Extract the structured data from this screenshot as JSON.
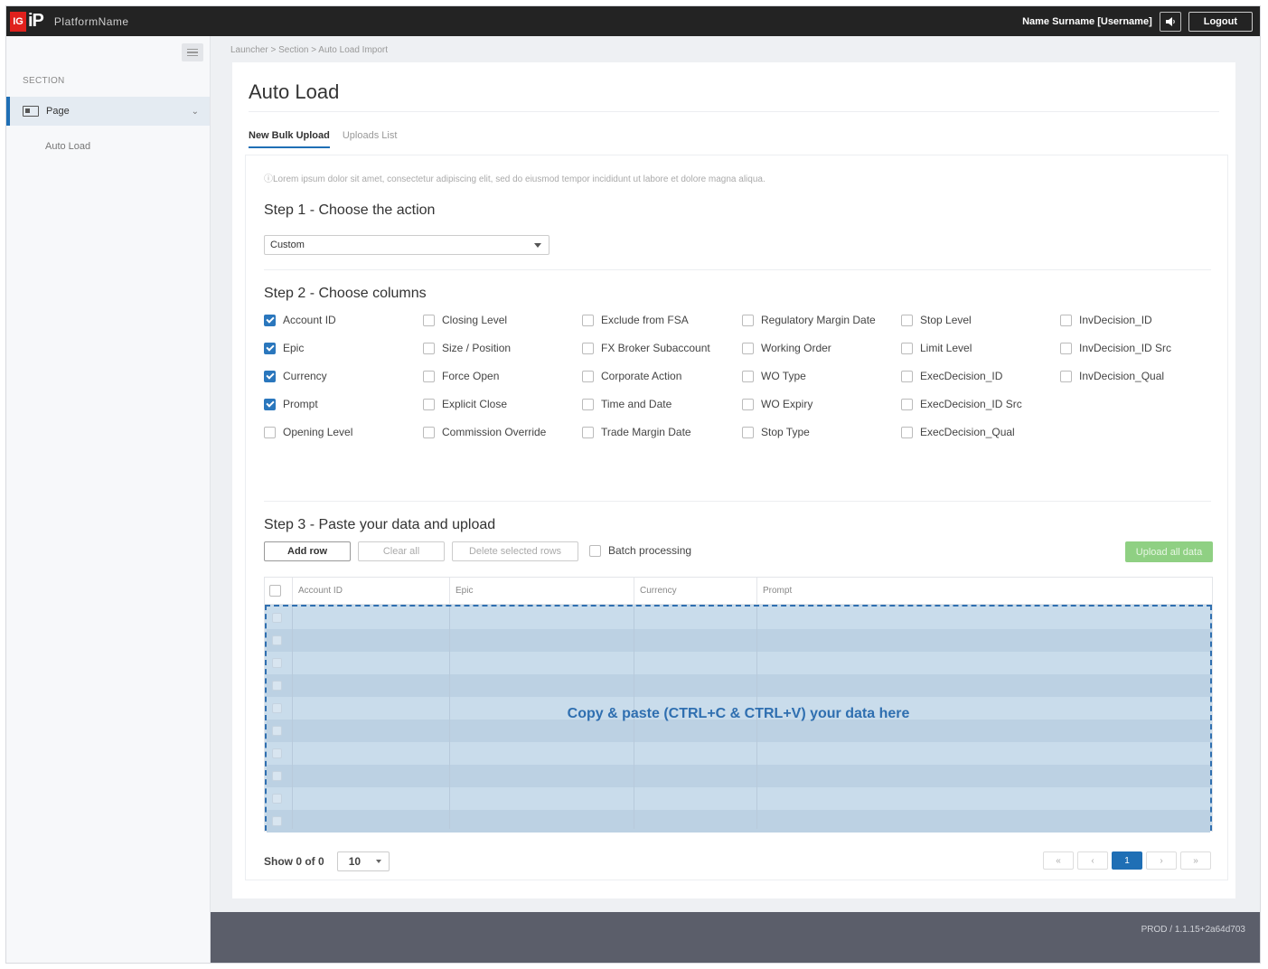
{
  "header": {
    "logo_ig": "IG",
    "logo_ip": "iP",
    "platform_name": "PlatformName",
    "user": "Name Surname [Username]",
    "logout_label": "Logout"
  },
  "sidebar": {
    "section_label": "SECTION",
    "item_label": "Page",
    "sub_item_label": "Auto Load"
  },
  "breadcrumb": "Launcher > Section > Auto Load Import",
  "page_title": "Auto Load",
  "tabs": [
    {
      "label": "New Bulk Upload",
      "active": true
    },
    {
      "label": "Uploads List",
      "active": false
    }
  ],
  "info_text": "ⓘLorem ipsum dolor sit amet, consectetur adipiscing elit, sed do eiusmod tempor incididunt ut labore et dolore magna aliqua.",
  "step1": {
    "title": "Step 1 - Choose the action",
    "selected": "Custom"
  },
  "step2": {
    "title": "Step 2 - Choose columns",
    "columns": [
      [
        {
          "label": "Account ID",
          "checked": true
        },
        {
          "label": "Epic",
          "checked": true
        },
        {
          "label": "Currency",
          "checked": true
        },
        {
          "label": "Prompt",
          "checked": true
        },
        {
          "label": "Opening Level",
          "checked": false
        }
      ],
      [
        {
          "label": "Closing Level",
          "checked": false
        },
        {
          "label": "Size / Position",
          "checked": false
        },
        {
          "label": "Force Open",
          "checked": false
        },
        {
          "label": "Explicit Close",
          "checked": false
        },
        {
          "label": "Commission Override",
          "checked": false
        }
      ],
      [
        {
          "label": "Exclude from FSA",
          "checked": false
        },
        {
          "label": "FX Broker Subaccount",
          "checked": false
        },
        {
          "label": "Corporate Action",
          "checked": false
        },
        {
          "label": "Time and Date",
          "checked": false
        },
        {
          "label": "Trade Margin Date",
          "checked": false
        }
      ],
      [
        {
          "label": "Regulatory Margin Date",
          "checked": false
        },
        {
          "label": "Working Order",
          "checked": false
        },
        {
          "label": "WO Type",
          "checked": false
        },
        {
          "label": "WO Expiry",
          "checked": false
        },
        {
          "label": "Stop Type",
          "checked": false
        }
      ],
      [
        {
          "label": "Stop Level",
          "checked": false
        },
        {
          "label": "Limit Level",
          "checked": false
        },
        {
          "label": "ExecDecision_ID",
          "checked": false
        },
        {
          "label": "ExecDecision_ID Src",
          "checked": false
        },
        {
          "label": "ExecDecision_Qual",
          "checked": false
        }
      ],
      [
        {
          "label": "InvDecision_ID",
          "checked": false
        },
        {
          "label": "InvDecision_ID Src",
          "checked": false
        },
        {
          "label": "InvDecision_Qual",
          "checked": false
        }
      ]
    ]
  },
  "step3": {
    "title": "Step 3 - Paste your data and upload",
    "add_row": "Add row",
    "clear_all": "Clear all",
    "delete_selected": "Delete selected rows",
    "batch_processing": "Batch processing",
    "upload_all": "Upload all data",
    "grid_headers": [
      "Account ID",
      "Epic",
      "Currency",
      "Prompt"
    ],
    "paste_message": "Copy & paste (CTRL+C   &  CTRL+V) your data here",
    "show_text": "Show 0 of 0",
    "page_size": "10",
    "pager": [
      "«",
      "‹",
      "1",
      "›",
      "»"
    ]
  },
  "footer": {
    "version": "PROD / 1.1.15+2a64d703"
  },
  "colors": {
    "accent": "#1f6fb5",
    "brand_red": "#e0211d",
    "upload_green": "#8fd083",
    "paste_area": "#c9dceb"
  }
}
